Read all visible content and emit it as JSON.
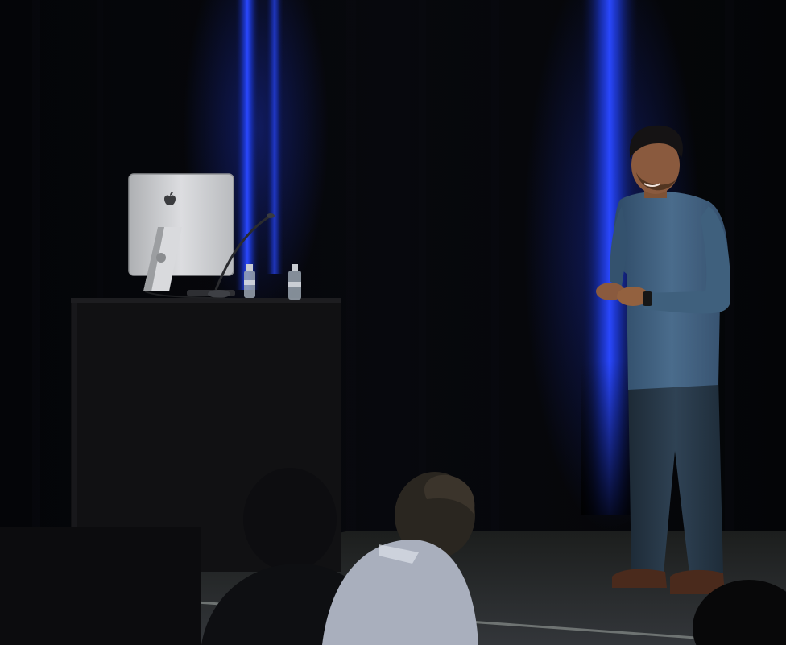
{
  "scene": {
    "description_tag": "stage-presentation",
    "palette": {
      "backdrop": "#050608",
      "curtain_light": "#1f3fe0",
      "stage_floor": "#2a2d2b",
      "podium": "#121214",
      "monitor_silver": "#c9cacc",
      "shirt": "#3f607d",
      "jeans": "#2a3b4a",
      "skin": "#8a5a3e",
      "hair": "#151314",
      "shoes": "#4a2a1c",
      "audience_shirt": "#a9afbd"
    },
    "icons": [
      "apple-logo-icon"
    ]
  }
}
